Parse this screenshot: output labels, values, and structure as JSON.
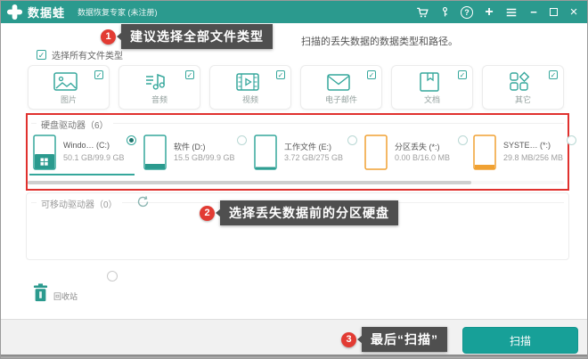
{
  "titlebar": {
    "app_name": "数据蛙",
    "subtitle": "数据恢复专家 (未注册)",
    "window_icons": [
      "cart",
      "key",
      "help",
      "plus",
      "menu",
      "minimize",
      "maximize",
      "close"
    ]
  },
  "colors": {
    "titlebar_teal": "#2b9a8e",
    "accent_teal": "#35a79c",
    "scan_button_teal": "#17a098",
    "annotation_red": "#e23b33",
    "highlight_border_red": "#e0312e",
    "tooltip_bg": "#4f4f4f",
    "drive_orange": "#f0a132"
  },
  "annotations": {
    "step1": {
      "number": "1",
      "text": "建议选择全部文件类型"
    },
    "step2": {
      "number": "2",
      "text": "选择丢失数据前的分区硬盘"
    },
    "step3": {
      "number": "3",
      "text": "最后“扫描”"
    }
  },
  "intro_text_visible": "扫描的丢失数据的数据类型和路径。",
  "select_all": {
    "label": "选择所有文件类型",
    "checked": true,
    "checkmark": "✓"
  },
  "file_types": [
    {
      "label": "图片",
      "icon": "image-icon",
      "checked": true
    },
    {
      "label": "音频",
      "icon": "audio-icon",
      "checked": true
    },
    {
      "label": "视频",
      "icon": "video-icon",
      "checked": true
    },
    {
      "label": "电子邮件",
      "icon": "email-icon",
      "checked": true
    },
    {
      "label": "文档",
      "icon": "document-icon",
      "checked": true
    },
    {
      "label": "其它",
      "icon": "other-icon",
      "checked": true
    }
  ],
  "hard_drives": {
    "title": "硬盘驱动器（6）",
    "drives": [
      {
        "name": "Windo… (C:)",
        "capacity": "50.1 GB/99.9 GB",
        "selected": true,
        "icon_color": "#35a79c",
        "fill_percent": 45,
        "has_windows_logo": true
      },
      {
        "name": "软件 (D:)",
        "capacity": "15.5 GB/99.9 GB",
        "selected": false,
        "icon_color": "#35a79c",
        "fill_percent": 14,
        "has_windows_logo": false
      },
      {
        "name": "工作文件 (E:)",
        "capacity": "3.72 GB/275 GB",
        "selected": false,
        "icon_color": "#35a79c",
        "fill_percent": 4,
        "has_windows_logo": false
      },
      {
        "name": "分区丢失 (*:)",
        "capacity": "0.00  B/16.0 MB",
        "selected": false,
        "icon_color": "#f0a132",
        "fill_percent": 0,
        "has_windows_logo": false
      },
      {
        "name": "SYSTE… (*:)",
        "capacity": "29.8 MB/256 MB",
        "selected": false,
        "icon_color": "#f0a132",
        "fill_percent": 12,
        "has_windows_logo": false
      }
    ]
  },
  "removable_drives": {
    "title": "可移动驱动器（0）"
  },
  "recycle_bin": {
    "label": "回收站"
  },
  "scan_button": {
    "label": "扫描"
  }
}
